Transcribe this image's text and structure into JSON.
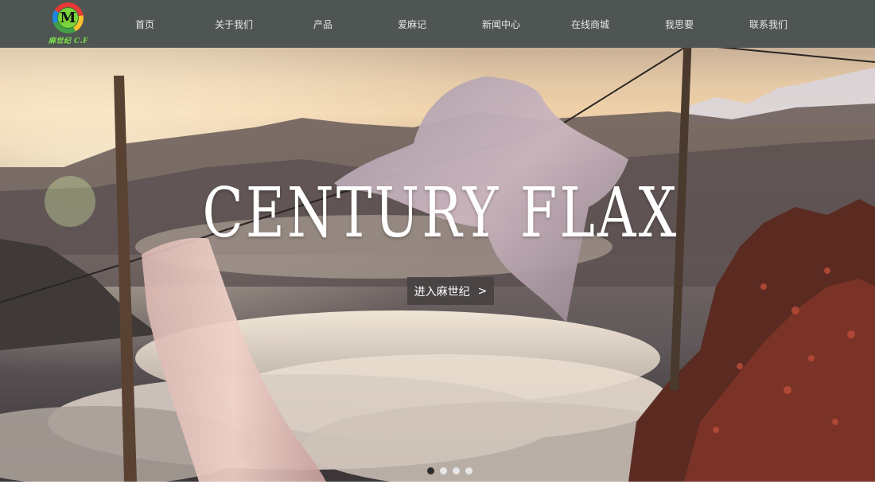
{
  "brand": {
    "logo_letter": "M",
    "logo_text": "麻世纪 C.F"
  },
  "nav": {
    "items": [
      {
        "label": "首页"
      },
      {
        "label": "关于我们"
      },
      {
        "label": "产品"
      },
      {
        "label": "爱麻记"
      },
      {
        "label": "新闻中心"
      },
      {
        "label": "在线商城"
      },
      {
        "label": "我思要"
      },
      {
        "label": "联系我们"
      }
    ]
  },
  "hero": {
    "title": "CENTURY FLAX",
    "button_label": "进入麻世纪",
    "button_arrow": ">",
    "slides_count": 4,
    "active_slide": 1
  },
  "colors": {
    "header_bg": "#4f5553",
    "nav_text": "#e8e8e8",
    "button_bg": "#484242",
    "dot_active": "#2d2d2d",
    "dot_inactive": "#e6e6e6"
  }
}
